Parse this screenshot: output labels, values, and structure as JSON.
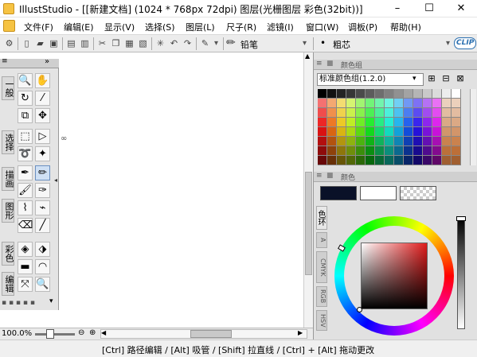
{
  "window": {
    "title": "IllustStudio - [[新建文档] (1024 * 768px 72dpi)   图层(光栅图层 彩色(32bit))]",
    "minimize": "–",
    "maximize": "☐",
    "close": "✕"
  },
  "menu": [
    "文件(F)",
    "编辑(E)",
    "显示(V)",
    "选择(S)",
    "图层(L)",
    "尺子(R)",
    "滤镜(I)",
    "窗口(W)",
    "调板(P)",
    "帮助(H)"
  ],
  "toolbar": {
    "pencil_label": "铅笔",
    "brush_label": "粗芯",
    "logo": "CLIP"
  },
  "tool_panel": {
    "tabs": [
      "一般",
      "选择",
      "描画",
      "图形",
      "彩色",
      "编辑"
    ]
  },
  "hbar": {
    "zoom": "100.0%"
  },
  "color_set_panel": {
    "header": "颜色组",
    "selected_set": "标准颜色组(1.2.0)"
  },
  "color_panel": {
    "header": "颜色",
    "wheel_tab": "色环",
    "side_tabs": [
      "A",
      "CMYK",
      "RGB",
      "HSV"
    ],
    "main_color": "#0a1128",
    "sub_color": "#ffffff"
  },
  "status": {
    "hint": "[Ctrl] 路径编辑 / [Alt] 吸管 / [Shift] 拉直线 / [Ctrl] + [Alt] 拖动更改"
  }
}
